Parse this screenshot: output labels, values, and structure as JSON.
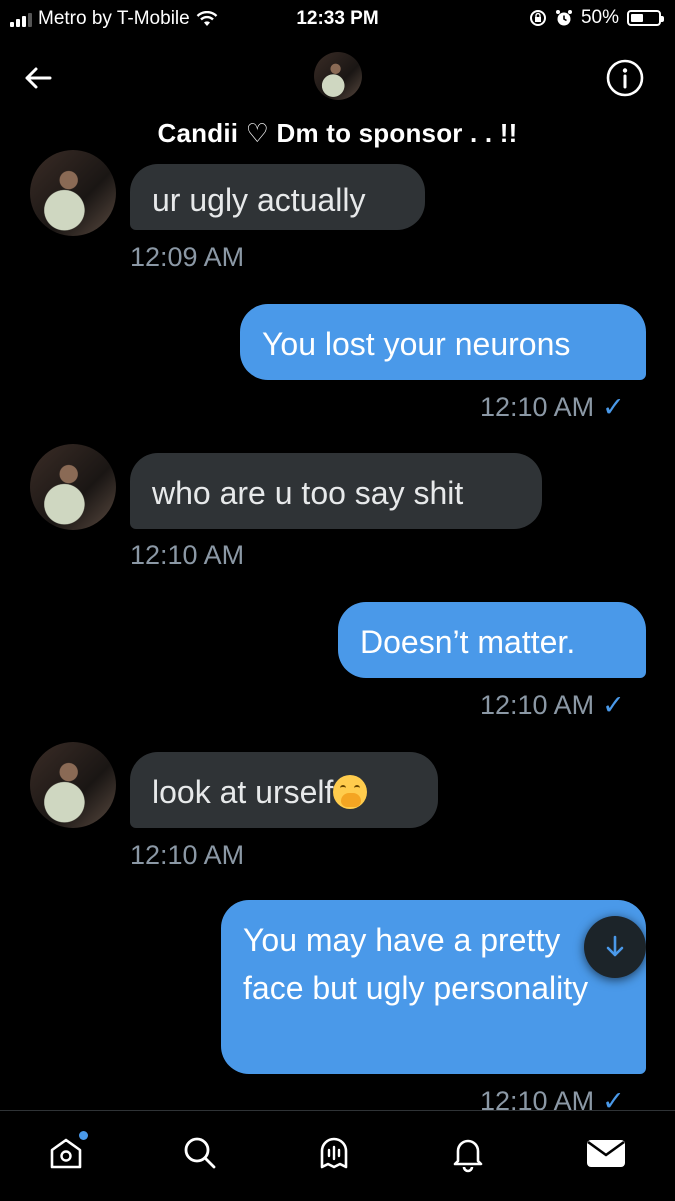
{
  "status_bar": {
    "carrier": "Metro by T-Mobile",
    "time": "12:33 PM",
    "battery": "50%"
  },
  "header": {
    "title": "Candii ♡ Dm to sponsor . . !!"
  },
  "messages": [
    {
      "direction": "in",
      "text": "ur ugly actually",
      "time": "12:09 AM"
    },
    {
      "direction": "out",
      "text": "You lost your neurons",
      "time": "12:10 AM",
      "read": "✓"
    },
    {
      "direction": "in",
      "text": "who are u too say shit",
      "time": "12:10 AM"
    },
    {
      "direction": "out",
      "text": "Doesn’t matter.",
      "time": "12:10 AM",
      "read": "✓"
    },
    {
      "direction": "in",
      "text": "look at urself",
      "emoji": "face-with-hand-over-mouth",
      "time": "12:10 AM"
    },
    {
      "direction": "out",
      "text": "You may have a pretty face but ugly personality",
      "time": "12:10 AM",
      "read": "✓"
    }
  ],
  "tab_bar": {
    "items": [
      "home-icon",
      "search-icon",
      "spaces-icon",
      "notifications-icon",
      "messages-icon"
    ],
    "home_has_dot": true
  },
  "colors": {
    "accent": "#4a99e9",
    "incoming_bubble": "#2f3336",
    "timestamp": "#8b98a5",
    "background": "#000000"
  }
}
